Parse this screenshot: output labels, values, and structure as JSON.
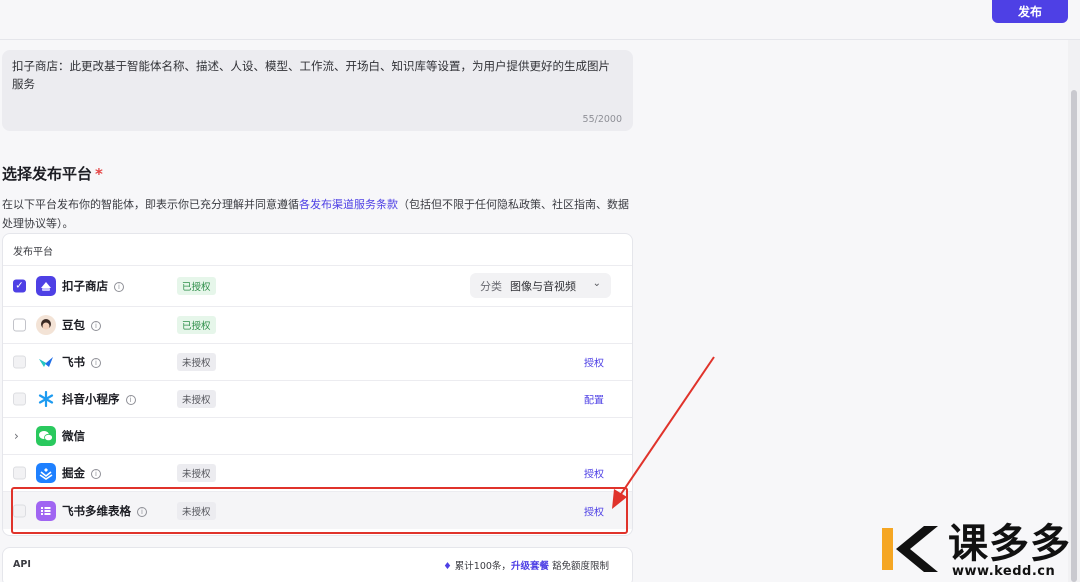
{
  "header": {
    "publish_label": "发布"
  },
  "description": {
    "text": "扣子商店：此更改基于智能体名称、描述、人设、模型、工作流、开场白、知识库等设置，为用户提供更好的生成图片服务",
    "count": "55/2000"
  },
  "section": {
    "title": "选择发布平台",
    "required_mark": "*",
    "desc_before": "在以下平台发布你的智能体，即表示你已充分理解并同意遵循",
    "desc_link": "各发布渠道服务条款",
    "desc_after": "（包括但不限于任何隐私政策、社区指南、数据处理协议等）。"
  },
  "platforms": {
    "header": "发布平台",
    "category_label": "分类",
    "category_value": "图像与音视频",
    "rows": [
      {
        "name": "扣子商店",
        "status": "已授权",
        "checked": true,
        "logo_color": "#4e40e5",
        "icon": "coze-store-icon"
      },
      {
        "name": "豆包",
        "status": "已授权",
        "checked": false,
        "icon": "doubao-icon"
      },
      {
        "name": "飞书",
        "status": "未授权",
        "action": "授权",
        "icon": "feishu-icon"
      },
      {
        "name": "抖音小程序",
        "status": "未授权",
        "action": "配置",
        "icon": "douyin-miniapp-icon"
      },
      {
        "name": "微信",
        "icon": "wechat-icon"
      },
      {
        "name": "掘金",
        "status": "未授权",
        "action": "授权",
        "icon": "juejin-icon"
      },
      {
        "name": "飞书多维表格",
        "status": "未授权",
        "action": "授权",
        "icon": "feishu-bitable-icon"
      }
    ]
  },
  "api": {
    "label": "API",
    "quota_text": "累计100条，",
    "upgrade_link": "升级套餐",
    "quota_suffix": "豁免额度限制"
  },
  "watermark": {
    "brand": "课多多",
    "url": "www.kedd.cn"
  },
  "colors": {
    "accent": "#4e40e5",
    "highlight": "#e0332b"
  }
}
